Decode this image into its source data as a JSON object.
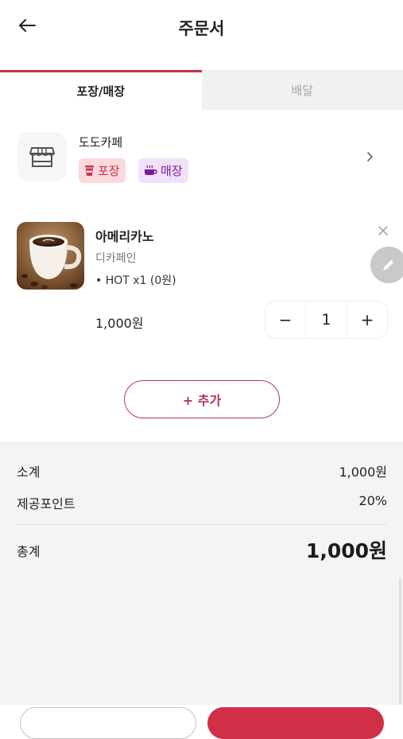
{
  "header": {
    "title": "주문서"
  },
  "tabs": [
    {
      "label": "포장/매장"
    },
    {
      "label": "배달"
    }
  ],
  "store": {
    "name": "도도카페",
    "badges": [
      {
        "label": "포장"
      },
      {
        "label": "매장"
      }
    ]
  },
  "cart_item": {
    "name": "아메리카노",
    "sub": "디카페인",
    "option_bullet": "•",
    "option": "HOT x1 (0원)",
    "price": "1,000원",
    "quantity": "1",
    "minus": "−",
    "plus": "+"
  },
  "add_button": {
    "label": "+ 추가"
  },
  "summary": {
    "subtotal_label": "소계",
    "subtotal_value": "1,000원",
    "points_label": "제공포인트",
    "points_value": "20%",
    "total_label": "총계",
    "total_value": "1,000원"
  },
  "colors": {
    "accent": "#c8324a",
    "takeout_bg": "#fbd9de",
    "dinein_bg": "#f1e1fb",
    "dinein_fg": "#7a1d9a"
  }
}
